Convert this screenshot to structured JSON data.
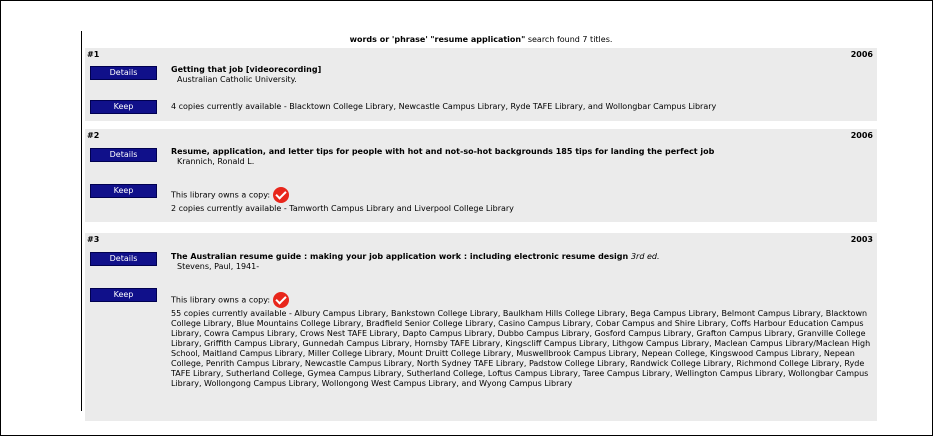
{
  "summary": {
    "prefix": "words or 'phrase'",
    "query": "\"resume application\"",
    "suffix": "search found 7 titles."
  },
  "records": [
    {
      "num": "#1",
      "year": "2006",
      "title": "Getting that job [videorecording]",
      "edition": "",
      "author": "Australian Catholic University.",
      "owns": "",
      "copies": "4 copies currently available - Blacktown College Library, Newcastle Campus Library, Ryde TAFE Library, and Wollongbar Campus Library",
      "details_label": "Details",
      "keep_label": "Keep"
    },
    {
      "num": "#2",
      "year": "2006",
      "title": "Resume, application, and letter tips for people with hot and not-so-hot backgrounds 185 tips for landing the perfect job",
      "edition": "",
      "author": "Krannich, Ronald L.",
      "owns": "This library owns a copy:",
      "copies": "2 copies currently available - Tamworth Campus Library and Liverpool College Library",
      "details_label": "Details",
      "keep_label": "Keep"
    },
    {
      "num": "#3",
      "year": "2003",
      "title": "The Australian resume guide : making your job application work : including electronic resume design",
      "edition": "3rd ed.",
      "author": "Stevens, Paul, 1941-",
      "owns": "This library owns a copy:",
      "copies": "55 copies currently available - Albury Campus Library, Bankstown College Library, Baulkham Hills College Library, Bega Campus Library, Belmont Campus Library, Blacktown College Library, Blue Mountains College Library, Bradfield Senior College Library, Casino Campus Library, Cobar Campus and Shire Library, Coffs Harbour Education Campus Library, Cowra Campus Library, Crows Nest TAFE Library, Dapto Campus Library, Dubbo Campus Library, Gosford Campus Library, Grafton Campus Library, Granville College Library, Griffith Campus Library, Gunnedah Campus Library, Hornsby TAFE Library, Kingscliff Campus Library, Lithgow Campus Library, Maclean Campus Library/Maclean High School, Maitland Campus Library, Miller College Library, Mount Druitt College Library, Muswellbrook Campus Library, Nepean College, Kingswood Campus Library, Nepean College, Penrith Campus Library, Newcastle Campus Library, North Sydney TAFE Library, Padstow College Library, Randwick College Library, Richmond College Library, Ryde TAFE Library, Sutherland College, Gymea Campus Library, Sutherland College, Loftus Campus Library, Taree Campus Library, Wellington Campus Library, Wollongbar Campus Library, Wollongong Campus Library, Wollongong West Campus Library, and Wyong Campus Library",
      "details_label": "Details",
      "keep_label": "Keep"
    }
  ]
}
